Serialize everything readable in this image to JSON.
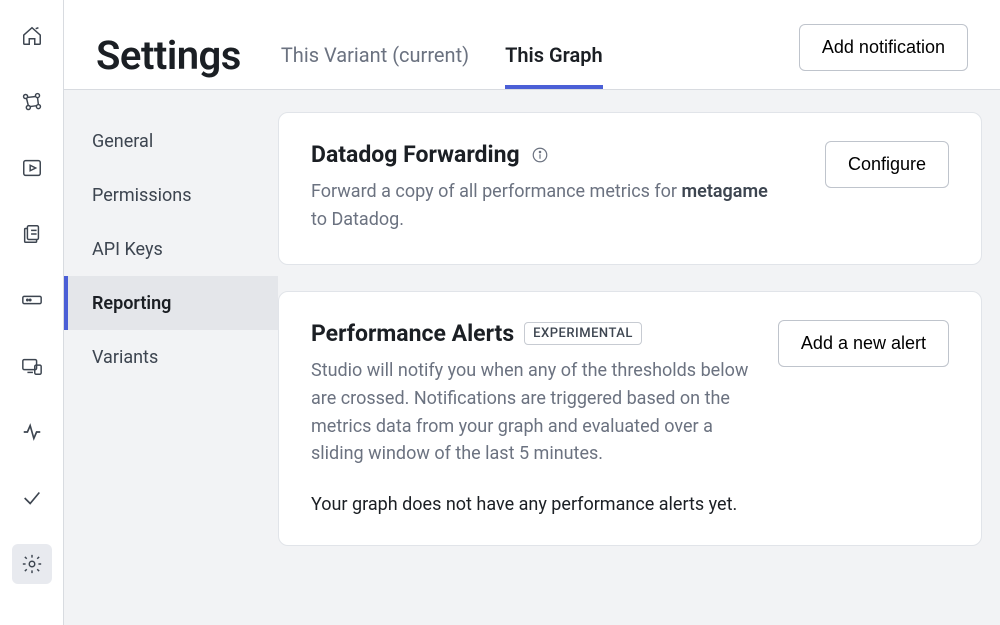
{
  "header": {
    "title": "Settings",
    "tabs": [
      {
        "label": "This Variant (current)",
        "active": false
      },
      {
        "label": "This Graph",
        "active": true
      }
    ],
    "add_notification_label": "Add notification"
  },
  "settings_nav": {
    "items": [
      {
        "label": "General",
        "active": false
      },
      {
        "label": "Permissions",
        "active": false
      },
      {
        "label": "API Keys",
        "active": false
      },
      {
        "label": "Reporting",
        "active": true
      },
      {
        "label": "Variants",
        "active": false
      }
    ]
  },
  "cards": {
    "datadog": {
      "title": "Datadog Forwarding",
      "desc_prefix": "Forward a copy of all performance metrics for ",
      "desc_bold": "metagame",
      "desc_suffix": " to Datadog.",
      "button_label": "Configure"
    },
    "alerts": {
      "title": "Performance Alerts",
      "badge": "EXPERIMENTAL",
      "desc": "Studio will notify you when any of the thresholds below are crossed. Notifications are triggered based on the metrics data from your graph and evaluated over a sliding window of the last 5 minutes.",
      "button_label": "Add a new alert",
      "empty_note": "Your graph does not have any performance alerts yet."
    }
  }
}
